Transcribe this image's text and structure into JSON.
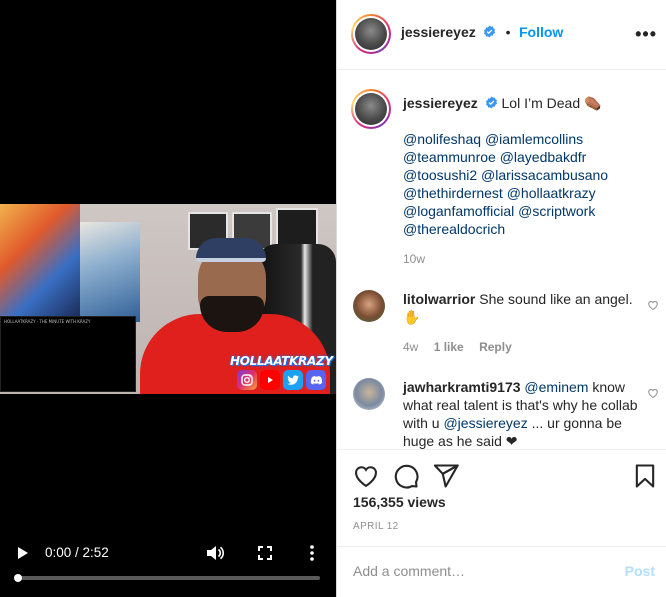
{
  "video": {
    "time_display": "0:00 / 2:52",
    "progress": 0.0,
    "overlay_brand": "HOLLAATKRAZY",
    "inset_text": "HOLLAATKRAZY · THE MINUTE WITH KRAZY",
    "social_icons": [
      "instagram-icon",
      "youtube-icon",
      "twitter-icon",
      "discord-icon"
    ]
  },
  "header": {
    "username": "jessiereyez",
    "separator": "•",
    "follow_label": "Follow",
    "more_label": "•••"
  },
  "caption": {
    "username": "jessiereyez",
    "text": "Lol I’m Dead",
    "emoji": "⚰️",
    "mentions": [
      "@nolifeshaq",
      "@iamlemcollins",
      "@teammunroe",
      "@layedbakdfr",
      "@toosushi2",
      "@larissacambusano",
      "@thethirdernest",
      "@hollaatkrazy",
      "@loganfamofficial",
      "@scriptwork",
      "@therealdocrich"
    ],
    "age": "10w"
  },
  "comments": [
    {
      "username": "litolwarrior",
      "text": "She sound like an angel.",
      "emoji": "✋",
      "age": "4w",
      "likes": "1 like",
      "reply_label": "Reply"
    },
    {
      "username": "jawharkramti9173",
      "mention": "@eminem",
      "text_a": "know what real talent is that's why he collab with u",
      "mention_b": "@jessiereyez",
      "text_b": "... ur gonna be huge as he said",
      "emoji": "❤"
    }
  ],
  "stats": {
    "views": "156,355 views",
    "date": "APRIL 12"
  },
  "compose": {
    "placeholder": "Add a comment…",
    "post_label": "Post"
  },
  "colors": {
    "accent": "#0095f6",
    "mention": "#00376b",
    "muted": "#8e8e8e",
    "post_disabled": "#b2dffc"
  }
}
